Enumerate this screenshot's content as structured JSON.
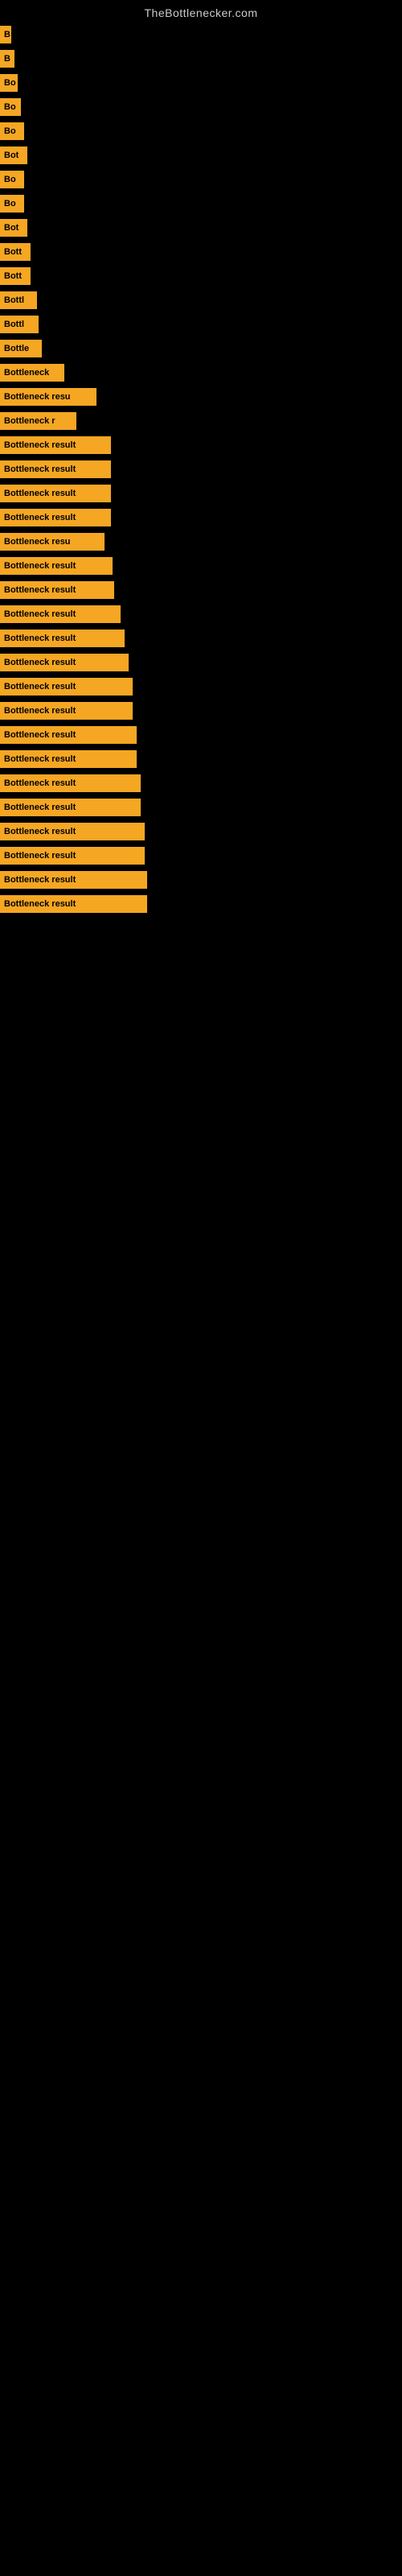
{
  "site": {
    "title": "TheBottlenecker.com"
  },
  "bars": [
    {
      "label": "B",
      "width": 14
    },
    {
      "label": "B",
      "width": 18
    },
    {
      "label": "Bo",
      "width": 22
    },
    {
      "label": "Bo",
      "width": 26
    },
    {
      "label": "Bo",
      "width": 30
    },
    {
      "label": "Bot",
      "width": 34
    },
    {
      "label": "Bo",
      "width": 30
    },
    {
      "label": "Bo",
      "width": 30
    },
    {
      "label": "Bot",
      "width": 34
    },
    {
      "label": "Bott",
      "width": 38
    },
    {
      "label": "Bott",
      "width": 38
    },
    {
      "label": "Bottl",
      "width": 46
    },
    {
      "label": "Bottl",
      "width": 48
    },
    {
      "label": "Bottle",
      "width": 52
    },
    {
      "label": "Bottleneck",
      "width": 80
    },
    {
      "label": "Bottleneck resu",
      "width": 120
    },
    {
      "label": "Bottleneck r",
      "width": 95
    },
    {
      "label": "Bottleneck result",
      "width": 138
    },
    {
      "label": "Bottleneck result",
      "width": 138
    },
    {
      "label": "Bottleneck result",
      "width": 138
    },
    {
      "label": "Bottleneck result",
      "width": 138
    },
    {
      "label": "Bottleneck resu",
      "width": 130
    },
    {
      "label": "Bottleneck result",
      "width": 140
    },
    {
      "label": "Bottleneck result",
      "width": 142
    },
    {
      "label": "Bottleneck result",
      "width": 150
    },
    {
      "label": "Bottleneck result",
      "width": 155
    },
    {
      "label": "Bottleneck result",
      "width": 160
    },
    {
      "label": "Bottleneck result",
      "width": 165
    },
    {
      "label": "Bottleneck result",
      "width": 165
    },
    {
      "label": "Bottleneck result",
      "width": 170
    },
    {
      "label": "Bottleneck result",
      "width": 170
    },
    {
      "label": "Bottleneck result",
      "width": 175
    },
    {
      "label": "Bottleneck result",
      "width": 175
    },
    {
      "label": "Bottleneck result",
      "width": 180
    },
    {
      "label": "Bottleneck result",
      "width": 180
    },
    {
      "label": "Bottleneck result",
      "width": 183
    },
    {
      "label": "Bottleneck result",
      "width": 183
    }
  ]
}
